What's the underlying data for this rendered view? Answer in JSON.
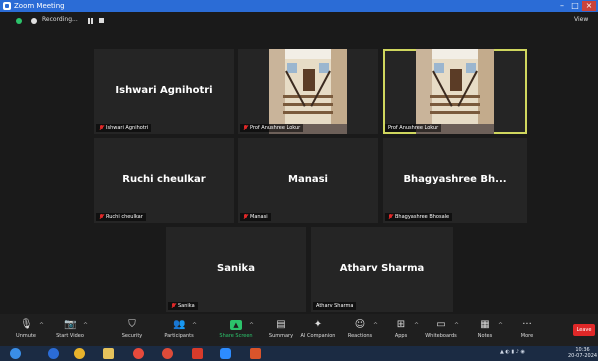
{
  "window": {
    "title": "Zoom Meeting"
  },
  "topbar": {
    "recording_label": "Recording...",
    "view_label": "View"
  },
  "participants": [
    {
      "name": "Ishwari Agnihotri",
      "tag": "Ishwari Agnihotri",
      "muted": true,
      "video": false,
      "active": false
    },
    {
      "name": "Prof Anushree Lokur",
      "tag": "Prof Anushree Lokur",
      "muted": true,
      "video": true,
      "active": false
    },
    {
      "name": "Prof Anushree Lokur",
      "tag": "Prof Anushree Lokur",
      "muted": false,
      "video": true,
      "active": true
    },
    {
      "name": "Ruchi cheulkar",
      "tag": "Ruchi cheulkar",
      "muted": true,
      "video": false,
      "active": false
    },
    {
      "name": "Manasi",
      "tag": "Manasi",
      "muted": true,
      "video": false,
      "active": false
    },
    {
      "name": "Bhagyashree  Bh...",
      "tag": "Bhagyashree Bhosale",
      "muted": true,
      "video": false,
      "active": false
    },
    {
      "name": "Sanika",
      "tag": "Sanika",
      "muted": true,
      "video": false,
      "active": false
    },
    {
      "name": "Atharv Sharma",
      "tag": "Atharv Sharma",
      "muted": false,
      "video": false,
      "active": false
    }
  ],
  "toolbar": {
    "buttons": [
      {
        "label": "Unmute",
        "icon": "microphone-muted-icon",
        "glyph": "🎙"
      },
      {
        "label": "Start Video",
        "icon": "camera-off-icon",
        "glyph": "📷"
      },
      {
        "label": "Security",
        "icon": "shield-icon",
        "glyph": "⛉"
      },
      {
        "label": "Participants",
        "icon": "participants-icon",
        "glyph": "👥",
        "badge": "8"
      },
      {
        "label": "Share Screen",
        "icon": "share-screen-icon",
        "glyph": "▲",
        "accent": "#2cc36b"
      },
      {
        "label": "Summary",
        "icon": "summary-icon",
        "glyph": "▤"
      },
      {
        "label": "AI Companion",
        "icon": "ai-companion-icon",
        "glyph": "✦"
      },
      {
        "label": "Reactions",
        "icon": "reactions-icon",
        "glyph": "☺"
      },
      {
        "label": "Apps",
        "icon": "apps-icon",
        "glyph": "⊞"
      },
      {
        "label": "Whiteboards",
        "icon": "whiteboard-icon",
        "glyph": "▭"
      },
      {
        "label": "Notes",
        "icon": "notes-icon",
        "glyph": "▦"
      },
      {
        "label": "More",
        "icon": "more-icon",
        "glyph": "···"
      }
    ],
    "end_label": "Leave"
  },
  "taskbar": {
    "clock_time": "10:36",
    "clock_date": "20-07-2024"
  },
  "colors": {
    "active_border": "#cfd65e",
    "muted_red": "#e02828",
    "share_green": "#2cc36b",
    "end_red": "#e02828"
  }
}
